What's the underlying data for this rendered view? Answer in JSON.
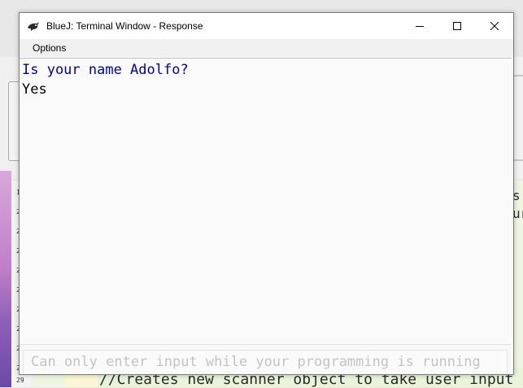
{
  "window": {
    "title": "BlueJ: Terminal Window - Response",
    "app_icon": "bluej-bird-icon",
    "controls": [
      "minimize-icon",
      "maximize-icon",
      "close-icon"
    ]
  },
  "menu": {
    "options_label": "Options"
  },
  "terminal": {
    "lines": [
      {
        "text": "Is your name Adolfo?",
        "color": "#0000aa"
      },
      {
        "text": "Yes",
        "color": "#000000"
      }
    ],
    "input_placeholder": "Can only enter input while your programming is running"
  },
  "background_editor": {
    "line_numbers": [
      "1",
      "2",
      "2",
      "2",
      "2",
      "2",
      "2",
      "2",
      "2",
      "2",
      "29"
    ],
    "code_line": "//Creates new scanner object to take user input",
    "right_edge_chars": [
      "s",
      "ur"
    ]
  },
  "colors": {
    "prompt_text": "#0000aa",
    "answer_text": "#000000",
    "placeholder_text": "#c4c4c4",
    "code_background": "#eef6e3"
  }
}
